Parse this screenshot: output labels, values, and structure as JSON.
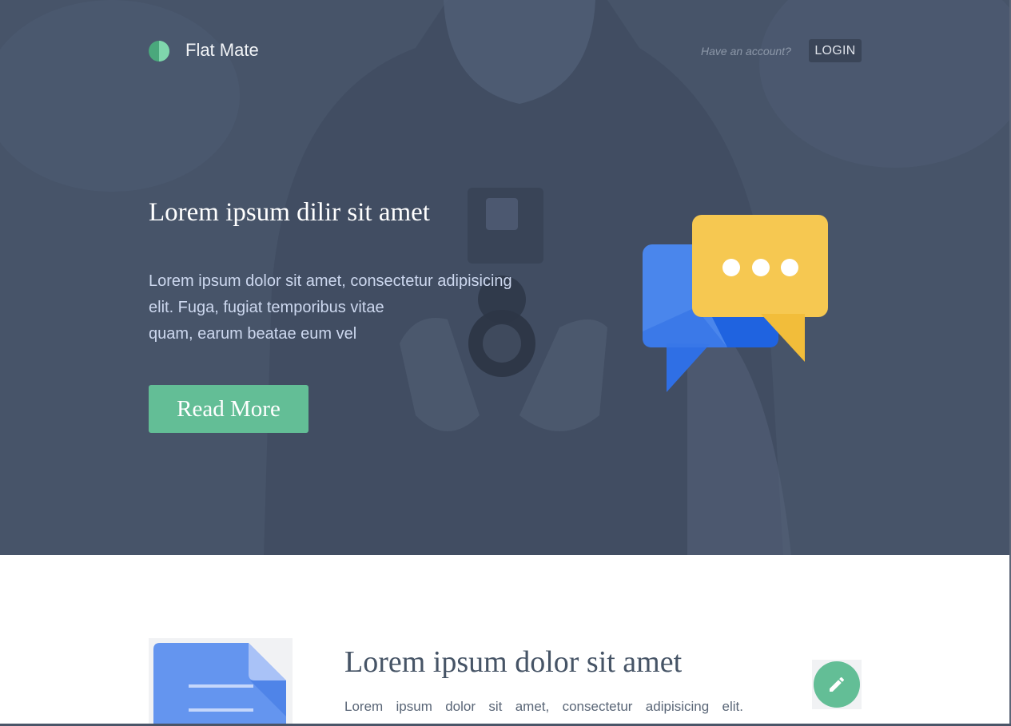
{
  "header": {
    "brand": "Flat Mate",
    "account_prompt": "Have an account?",
    "login_label": "LOGIN",
    "logo_colors": [
      "#4aa87c",
      "#7fd6ac"
    ]
  },
  "hero": {
    "title": "Lorem ipsum dilir sit amet",
    "text_lines": [
      "Lorem ipsum dolor sit amet, consectetur adipisicing",
      "elit. Fuga, fugiat temporibus vitae",
      "quam, earum beatae eum vel"
    ],
    "cta_label": "Read More",
    "illustration": "chat-bubbles-icon"
  },
  "feature": {
    "title": "Lorem ipsum dolor sit amet",
    "text": "Lorem ipsum dolor sit amet, consectetur adipisicing elit.",
    "image": "document-icon",
    "action_icon": "pencil-icon"
  },
  "colors": {
    "hero_overlay": "#475469",
    "accent_green": "#63be96",
    "chat_blue": "#4a86ec",
    "chat_yellow": "#f6c851",
    "doc_blue": "#6495ef",
    "text_dark": "#465466"
  }
}
